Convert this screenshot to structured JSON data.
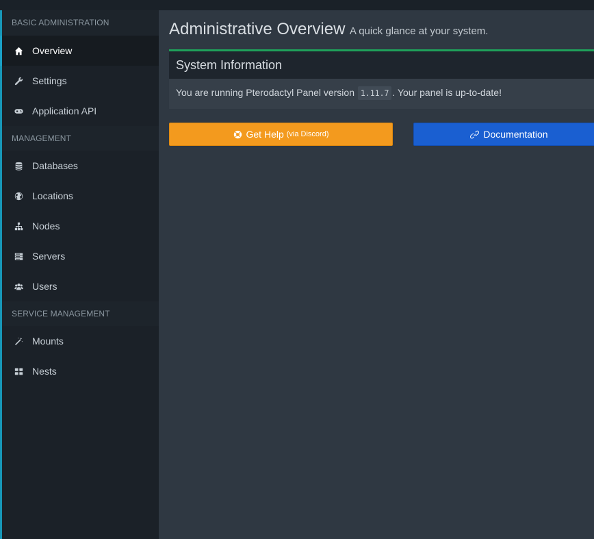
{
  "sidebar": {
    "sections": [
      {
        "header": "BASIC ADMINISTRATION",
        "items": [
          {
            "label": "Overview",
            "icon": "home-icon",
            "active": true
          },
          {
            "label": "Settings",
            "icon": "wrench-icon"
          },
          {
            "label": "Application API",
            "icon": "gamepad-icon"
          }
        ]
      },
      {
        "header": "MANAGEMENT",
        "items": [
          {
            "label": "Databases",
            "icon": "database-icon"
          },
          {
            "label": "Locations",
            "icon": "globe-icon"
          },
          {
            "label": "Nodes",
            "icon": "sitemap-icon"
          },
          {
            "label": "Servers",
            "icon": "server-icon"
          },
          {
            "label": "Users",
            "icon": "users-icon"
          }
        ]
      },
      {
        "header": "SERVICE MANAGEMENT",
        "items": [
          {
            "label": "Mounts",
            "icon": "magic-icon"
          },
          {
            "label": "Nests",
            "icon": "th-large-icon"
          }
        ]
      }
    ]
  },
  "header": {
    "title": "Administrative Overview",
    "subtitle": "A quick glance at your system."
  },
  "system_info": {
    "title": "System Information",
    "text_before": "You are running Pterodactyl Panel version",
    "version": "1.11.7",
    "text_after": ". Your panel is up-to-date!"
  },
  "buttons": {
    "help_label": "Get Help",
    "help_sub": "(via Discord)",
    "docs_label": "Documentation"
  },
  "colors": {
    "accent": "#1aa0c6",
    "success": "#1fa05a",
    "warning": "#f39a1e",
    "primary": "#1a5fd1"
  }
}
